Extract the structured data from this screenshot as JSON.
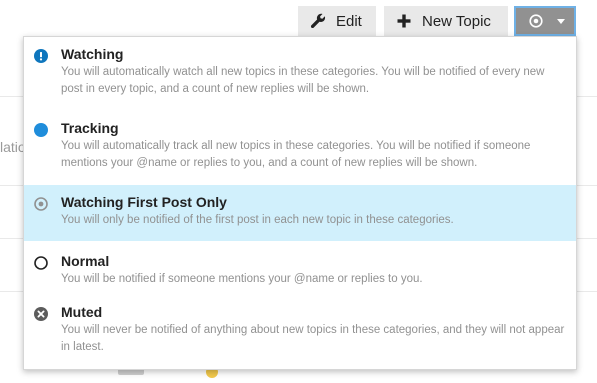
{
  "toolbar": {
    "edit_label": "Edit",
    "new_topic_label": "New Topic",
    "notification_button": {
      "icon": "watching-first-post-icon"
    }
  },
  "background": {
    "fragment_text": "latio"
  },
  "dropdown": {
    "selected_index": 2,
    "options": [
      {
        "title": "Watching",
        "description": "You will automatically watch all new topics in these categories. You will be notified of every new post in every topic, and a count of new replies will be shown.",
        "icon": "exclamation-circle-icon",
        "icon_color": "#0e76bd"
      },
      {
        "title": "Tracking",
        "description": "You will automatically track all new topics in these categories. You will be notified if someone mentions your @name or replies to you, and a count of new replies will be shown.",
        "icon": "filled-circle-icon",
        "icon_color": "#1f8ddb"
      },
      {
        "title": "Watching First Post Only",
        "description": "You will only be notified of the first post in each new topic in these categories.",
        "icon": "dot-circle-icon",
        "icon_color": "#919191"
      },
      {
        "title": "Normal",
        "description": "You will be notified if someone mentions your @name or replies to you.",
        "icon": "empty-circle-icon",
        "icon_color": "#222222"
      },
      {
        "title": "Muted",
        "description": "You will never be notified of anything about new topics in these categories, and they will not appear in latest.",
        "icon": "times-circle-icon",
        "icon_color": "#5c5c5c"
      }
    ]
  }
}
